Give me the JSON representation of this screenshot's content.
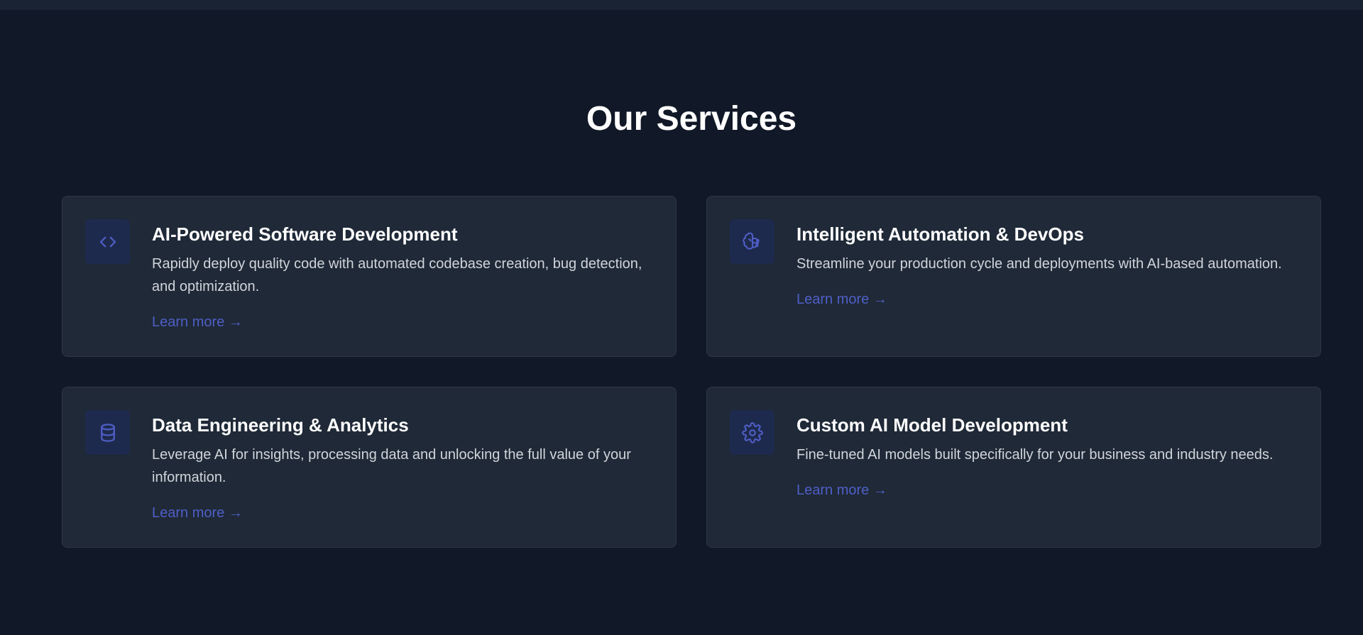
{
  "section": {
    "title": "Our Services"
  },
  "services": [
    {
      "icon": "code-icon",
      "title": "AI-Powered Software Development",
      "description": "Rapidly deploy quality code with automated codebase creation, bug detection, and optimization.",
      "link": "Learn more →"
    },
    {
      "icon": "brain-icon",
      "title": "Intelligent Automation & DevOps",
      "description": "Streamline your production cycle and deployments with AI-based automation.",
      "link": "Learn more →"
    },
    {
      "icon": "database-icon",
      "title": "Data Engineering & Analytics",
      "description": "Leverage AI for insights, processing data and unlocking the full value of your information.",
      "link": "Learn more →"
    },
    {
      "icon": "gear-icon",
      "title": "Custom AI Model Development",
      "description": "Fine-tuned AI models built specifically for your business and industry needs.",
      "link": "Learn more →"
    }
  ],
  "colors": {
    "background": "#111827",
    "card": "#1f2937",
    "accent": "#4f5fc7"
  }
}
